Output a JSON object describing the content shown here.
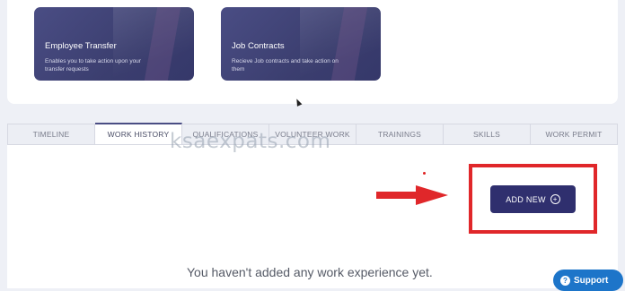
{
  "cards": [
    {
      "title": "Employee Transfer",
      "desc": "Enables you to take action upon your transfer requests"
    },
    {
      "title": "Job Contracts",
      "desc": "Recieve Job contracts and take action on them"
    }
  ],
  "tabs": [
    {
      "label": "TIMELINE"
    },
    {
      "label": "WORK HISTORY"
    },
    {
      "label": "QUALIFICATIONS"
    },
    {
      "label": "VOLUNTEER WORK"
    },
    {
      "label": "TRAININGS"
    },
    {
      "label": "SKILLS"
    },
    {
      "label": "WORK PERMIT"
    }
  ],
  "active_tab": "WORK HISTORY",
  "watermark": "ksaexpats.com",
  "add_button": {
    "label": "ADD NEW",
    "icon": "plus-circle-icon"
  },
  "empty_message": "You haven't added any work experience yet.",
  "support": {
    "label": "Support",
    "icon": "help-icon"
  },
  "colors": {
    "accent": "#2f2f6e",
    "highlight": "#e0272a",
    "support": "#1d75c9"
  }
}
